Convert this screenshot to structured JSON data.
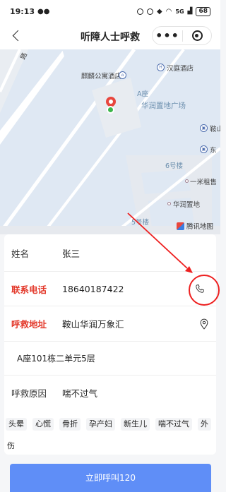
{
  "status_bar": {
    "time": "19:13",
    "network": "5G",
    "battery": "68"
  },
  "nav": {
    "title": "听障人士呼救",
    "more": "•••"
  },
  "map": {
    "labels": {
      "road": "路",
      "hotel1": "麒麟公寓酒店",
      "hotel2": "汉庭酒店",
      "zone_a": "A座",
      "plaza": "华润置地广场",
      "anshan": "鞍山",
      "dong": "东",
      "building6": "6号楼",
      "rental": "一米租售",
      "huarun": "华润置地",
      "building5": "5号楼",
      "watermark": "腾讯地图"
    }
  },
  "form": {
    "name": {
      "label": "姓名",
      "value": "张三"
    },
    "phone": {
      "label": "联系电话",
      "value": "18640187422"
    },
    "address": {
      "label": "呼救地址",
      "value": "鞍山华润万象汇",
      "detail": "A座101栋二单元5层"
    },
    "reason": {
      "label": "呼救原因",
      "value": "喘不过气"
    },
    "tags": [
      "头晕",
      "心慌",
      "骨折",
      "孕产妇",
      "新生儿",
      "喘不过气",
      "外"
    ],
    "tag_tail": "伤"
  },
  "action": {
    "call_label": "立即呼叫120"
  },
  "colors": {
    "accent": "#5f8ef7",
    "required": "#e3392b",
    "annotation": "#ee2020"
  },
  "icons": {
    "back": "chevron-left-icon",
    "phone": "phone-icon",
    "location": "location-pin-icon",
    "close": "target-icon"
  }
}
